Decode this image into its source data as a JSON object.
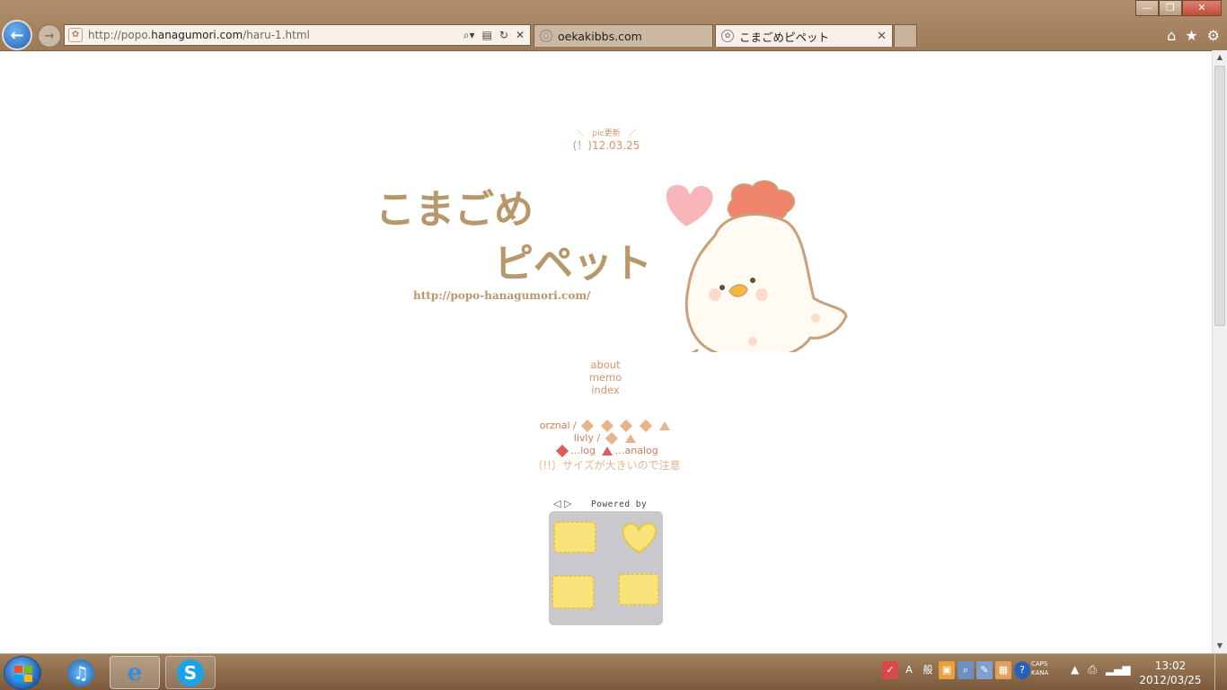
{
  "browser": {
    "address": {
      "prefix": "http://popo.",
      "host": "hanagumori.com",
      "path": "/haru-1.html"
    },
    "tabs": [
      {
        "label": "oekakibbs.com",
        "active": false
      },
      {
        "label": "こまごめピペット",
        "active": true
      }
    ],
    "icons": [
      "back-icon",
      "forward-icon",
      "search-icon",
      "refresh-icon",
      "stop-icon",
      "home-icon",
      "favorites-icon",
      "tools-icon"
    ]
  },
  "page": {
    "update_heading": "＼　pic更新　／",
    "update_date": "(！)12.03.25",
    "title_line1": "こまごめ",
    "title_line2": "ピペット",
    "site_url": "http://popo-hanagumori.com/",
    "nav": [
      {
        "label": "about"
      },
      {
        "label": "memo"
      },
      {
        "label": "index"
      }
    ],
    "gallery": {
      "orznal_label": "orznal /",
      "livly_label": "livly /",
      "legend_log": "…log",
      "legend_analog": "…analog",
      "warning": "（!!）サイズが大きいので注意"
    },
    "widget": {
      "arrows": "◁ ▷",
      "powered_by": "Powered by"
    },
    "colors": {
      "title": "#b8976b",
      "link": "#d9946a",
      "accent_red": "#e05a5a",
      "accent_peach": "#e8b48e"
    }
  },
  "taskbar": {
    "apps": [
      "start-button",
      "itunes",
      "internet-explorer",
      "skype"
    ],
    "caps": "CAPS",
    "kana": "KANA",
    "ime_mode": "A",
    "ime_kanji": "般",
    "clock_time": "13:02",
    "clock_date": "2012/03/25"
  }
}
